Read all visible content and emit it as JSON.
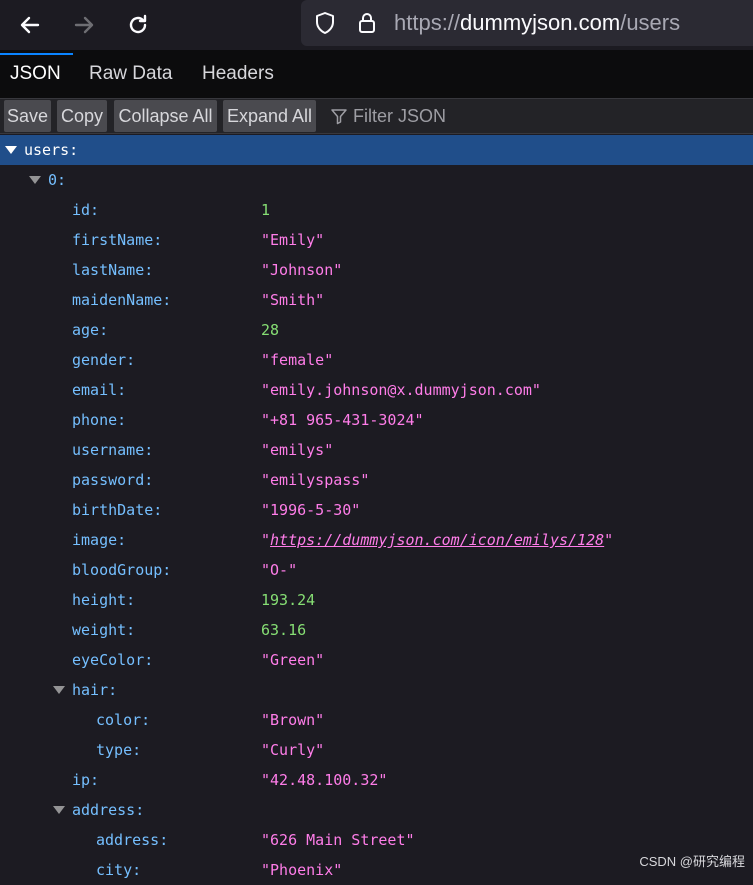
{
  "browser": {
    "url_prefix": "https://",
    "url_host": "dummyjson.com",
    "url_path": "/users"
  },
  "tabs": [
    "JSON",
    "Raw Data",
    "Headers"
  ],
  "toolbar": {
    "save": "Save",
    "copy": "Copy",
    "collapse_all": "Collapse All",
    "expand_all": "Expand All",
    "filter_placeholder": "Filter JSON"
  },
  "tree": {
    "root_key": "users:",
    "index_key": "0:",
    "fields": [
      {
        "key": "id:",
        "value": "1",
        "type": "num"
      },
      {
        "key": "firstName:",
        "value": "\"Emily\"",
        "type": "str"
      },
      {
        "key": "lastName:",
        "value": "\"Johnson\"",
        "type": "str"
      },
      {
        "key": "maidenName:",
        "value": "\"Smith\"",
        "type": "str"
      },
      {
        "key": "age:",
        "value": "28",
        "type": "num"
      },
      {
        "key": "gender:",
        "value": "\"female\"",
        "type": "str"
      },
      {
        "key": "email:",
        "value": "\"emily.johnson@x.dummyjson.com\"",
        "type": "str"
      },
      {
        "key": "phone:",
        "value": "\"+81 965-431-3024\"",
        "type": "str"
      },
      {
        "key": "username:",
        "value": "\"emilys\"",
        "type": "str"
      },
      {
        "key": "password:",
        "value": "\"emilyspass\"",
        "type": "str"
      },
      {
        "key": "birthDate:",
        "value": "\"1996-5-30\"",
        "type": "str"
      },
      {
        "key": "image:",
        "value": "https://dummyjson.com/icon/emilys/128",
        "type": "link"
      },
      {
        "key": "bloodGroup:",
        "value": "\"O-\"",
        "type": "str"
      },
      {
        "key": "height:",
        "value": "193.24",
        "type": "num"
      },
      {
        "key": "weight:",
        "value": "63.16",
        "type": "num"
      },
      {
        "key": "eyeColor:",
        "value": "\"Green\"",
        "type": "str"
      }
    ],
    "hair": {
      "key": "hair:",
      "fields": [
        {
          "key": "color:",
          "value": "\"Brown\"",
          "type": "str"
        },
        {
          "key": "type:",
          "value": "\"Curly\"",
          "type": "str"
        }
      ]
    },
    "ip": {
      "key": "ip:",
      "value": "\"42.48.100.32\"",
      "type": "str"
    },
    "address": {
      "key": "address:",
      "fields": [
        {
          "key": "address:",
          "value": "\"626 Main Street\"",
          "type": "str"
        },
        {
          "key": "city:",
          "value": "\"Phoenix\"",
          "type": "str"
        }
      ]
    }
  },
  "watermark": "CSDN @研究编程"
}
